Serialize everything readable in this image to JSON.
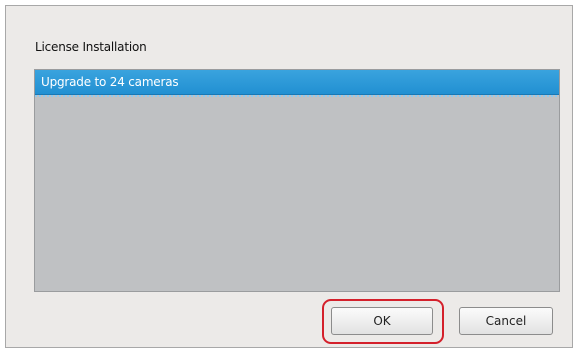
{
  "dialog": {
    "title": "License Installation",
    "list": {
      "items": [
        {
          "label": "Upgrade to 24 cameras",
          "selected": true
        }
      ]
    },
    "buttons": {
      "ok_label": "OK",
      "cancel_label": "Cancel"
    },
    "highlight": {
      "target": "ok-button",
      "color": "#d4202b"
    }
  },
  "colors": {
    "selection": "#2c98d8",
    "list_background": "#bfc1c3",
    "dialog_background": "#eceae8"
  }
}
